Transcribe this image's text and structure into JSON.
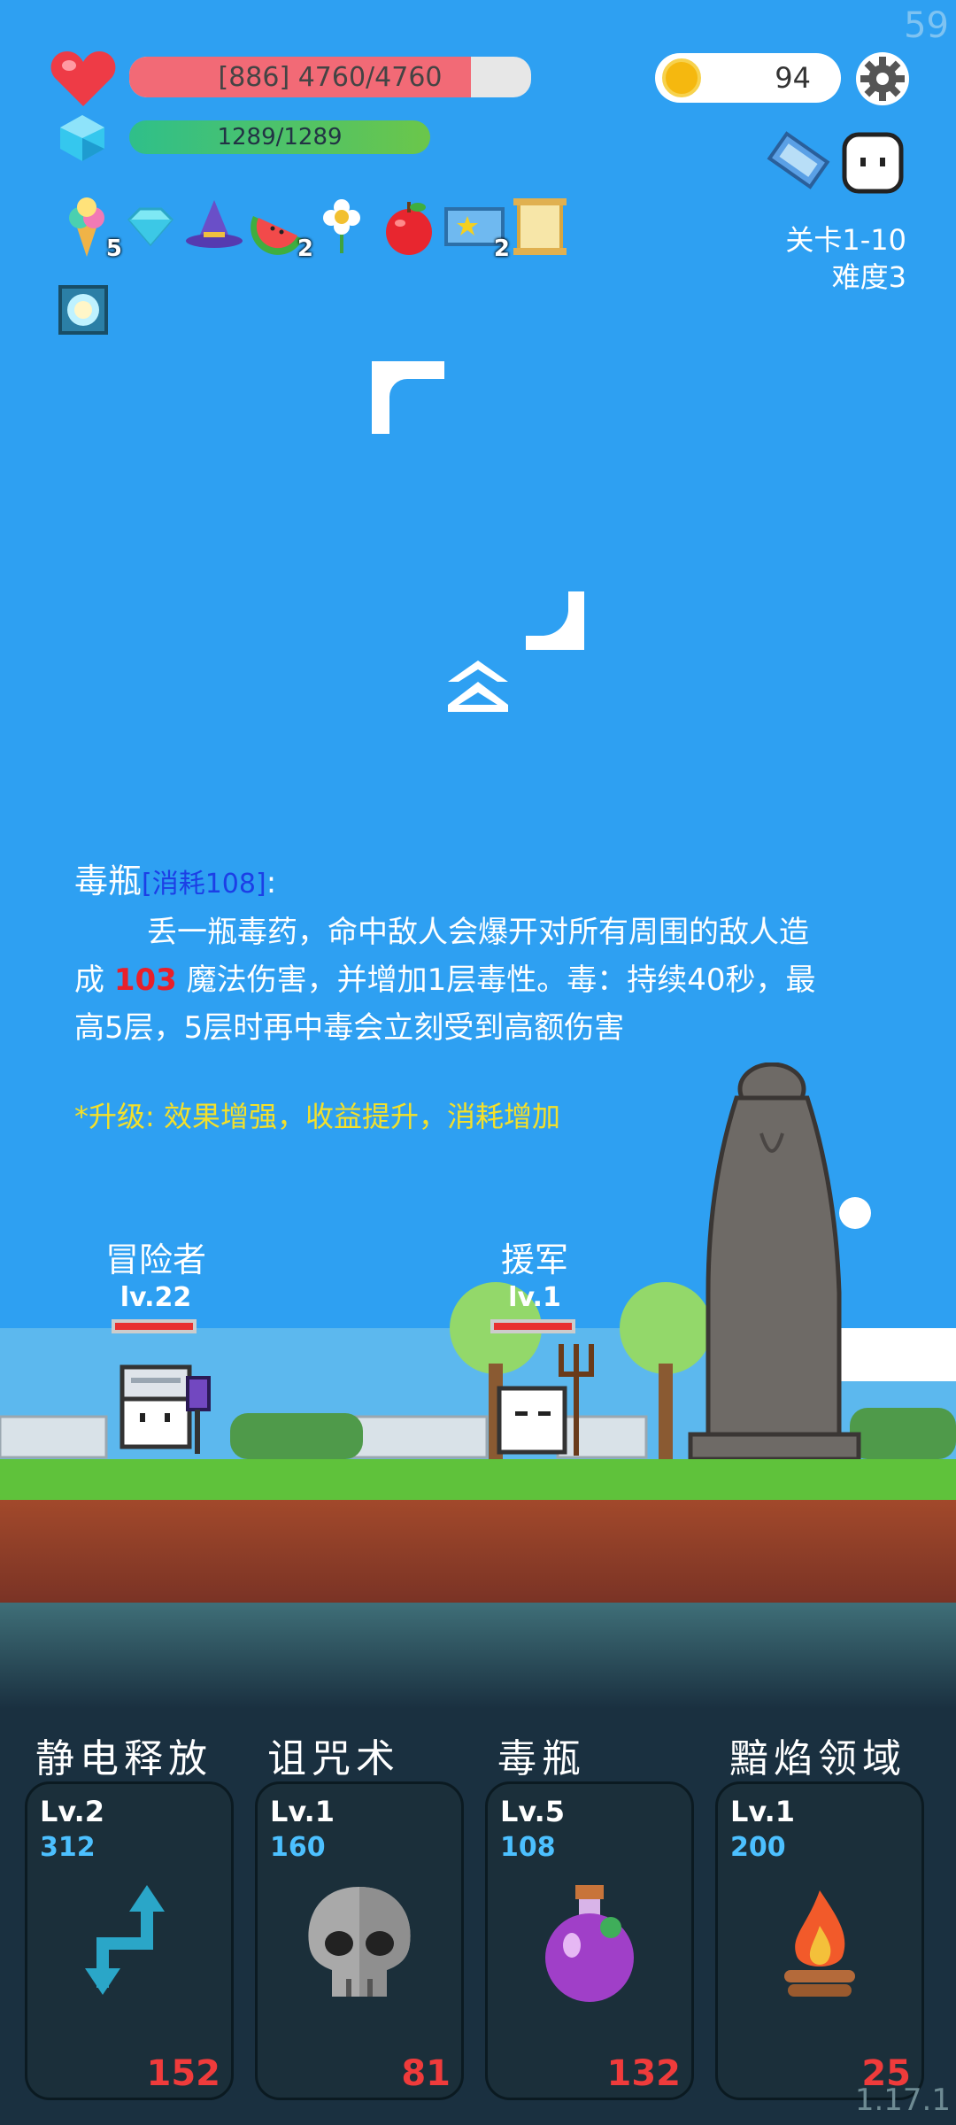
{
  "fps": "59",
  "version": "1.17.1",
  "hp": {
    "text": "[886]  4760/4760",
    "fraction": 0.85,
    "color": "#f26a76"
  },
  "mp": {
    "text": "1289/1289",
    "fraction": 1.0
  },
  "coins": "94",
  "inventory": [
    {
      "icon": "ice-cream-icon",
      "count": "5"
    },
    {
      "icon": "diamond-icon",
      "count": ""
    },
    {
      "icon": "wizard-hat-icon",
      "count": ""
    },
    {
      "icon": "watermelon-icon",
      "count": "2"
    },
    {
      "icon": "flower-icon",
      "count": ""
    },
    {
      "icon": "apple-icon",
      "count": ""
    },
    {
      "icon": "star-card-icon",
      "count": "2"
    },
    {
      "icon": "scroll-icon",
      "count": ""
    }
  ],
  "stage": {
    "level": "关卡1-10",
    "difficulty": "难度3"
  },
  "skill_desc": {
    "title": "毒瓶",
    "cost": "[消耗108]",
    "colon": ":",
    "line1": "丢一瓶毒药，命中敌人会爆开对所有周围的敌人造",
    "line2_pre": "成 ",
    "damage": "103",
    "line2_post": " 魔法伤害，并增加1层毒性。毒：持续40秒，最",
    "line3": "高5层，5层时再中毒会立刻受到高额伤害",
    "upgrade": "*升级: 效果增强，收益提升，消耗增加"
  },
  "units": {
    "adventurer": {
      "name": "冒险者",
      "level": "lv.22"
    },
    "reinforcement": {
      "name": "援军",
      "level": "lv.1"
    }
  },
  "skills": [
    {
      "name": "静电释放",
      "level": "Lv.2",
      "cost": "312",
      "count": "152",
      "icon": "arrows-icon"
    },
    {
      "name": "诅咒术",
      "level": "Lv.1",
      "cost": "160",
      "count": "81",
      "icon": "skull-icon"
    },
    {
      "name": "毒瓶",
      "level": "Lv.5",
      "cost": "108",
      "count": "132",
      "icon": "poison-bottle-icon"
    },
    {
      "name": "黯焰领域",
      "level": "Lv.1",
      "cost": "200",
      "count": "25",
      "icon": "campfire-icon"
    }
  ]
}
